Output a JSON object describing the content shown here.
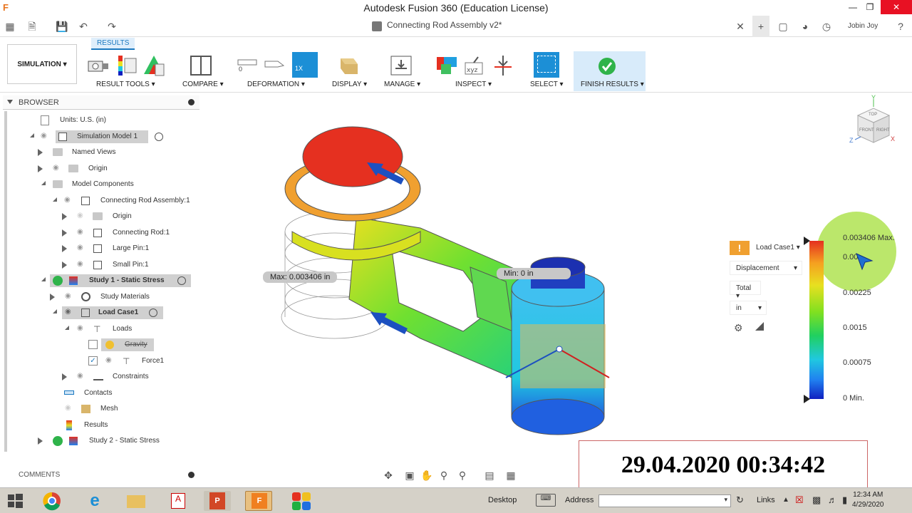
{
  "window": {
    "title": "Autodesk Fusion 360 (Education License)"
  },
  "appbar": {
    "document_title": "Connecting Rod Assembly v2*",
    "user_name": "Jobin Joy"
  },
  "ribbon": {
    "active_tab": "RESULTS",
    "workspace": "SIMULATION",
    "groups": [
      {
        "label": "RESULT TOOLS"
      },
      {
        "label": "COMPARE"
      },
      {
        "label": "DEFORMATION"
      },
      {
        "label": "DISPLAY"
      },
      {
        "label": "MANAGE"
      },
      {
        "label": "INSPECT"
      },
      {
        "label": "SELECT"
      },
      {
        "label": "FINISH RESULTS"
      }
    ],
    "deformation_zero": "0",
    "deformation_scale": "1X"
  },
  "browser": {
    "title": "BROWSER",
    "units": "Units: U.S. (in)",
    "items": [
      {
        "label": "Simulation Model 1"
      },
      {
        "label": "Named Views"
      },
      {
        "label": "Origin"
      },
      {
        "label": "Model Components"
      },
      {
        "label": "Connecting Rod Assembly:1"
      },
      {
        "label": "Origin"
      },
      {
        "label": "Connecting Rod:1"
      },
      {
        "label": "Large Pin:1"
      },
      {
        "label": "Small Pin:1"
      },
      {
        "label": "Study 1 - Static Stress"
      },
      {
        "label": "Study Materials"
      },
      {
        "label": "Load Case1"
      },
      {
        "label": "Loads"
      },
      {
        "label": "Gravity"
      },
      {
        "label": "Force1"
      },
      {
        "label": "Constraints"
      },
      {
        "label": "Contacts"
      },
      {
        "label": "Mesh"
      },
      {
        "label": "Results"
      },
      {
        "label": "Study 2 - Static Stress"
      }
    ]
  },
  "comments": {
    "title": "COMMENTS"
  },
  "viewport": {
    "max_callout": "Max: 0.003406 in",
    "min_callout": "Min: 0 in",
    "viewcube": {
      "top": "TOP",
      "front": "FRONT",
      "right": "RIGHT",
      "axis_x": "X",
      "axis_y": "Y",
      "axis_z": "Z"
    }
  },
  "legend": {
    "load_case": "Load Case1",
    "result_type": "Displacement",
    "component": "Total",
    "units": "in",
    "ticks": [
      "0.003406 Max.",
      "0.00",
      "0.00225",
      "0.0015",
      "0.00075",
      "0 Min."
    ],
    "colors": {
      "max": "#e53020",
      "min": "#1020c0"
    }
  },
  "timestamp": "29.04.2020 00:34:42",
  "taskbar": {
    "desktop_label": "Desktop",
    "address_label": "Address",
    "links_label": "Links",
    "time": "12:34 AM",
    "date": "4/29/2020"
  }
}
